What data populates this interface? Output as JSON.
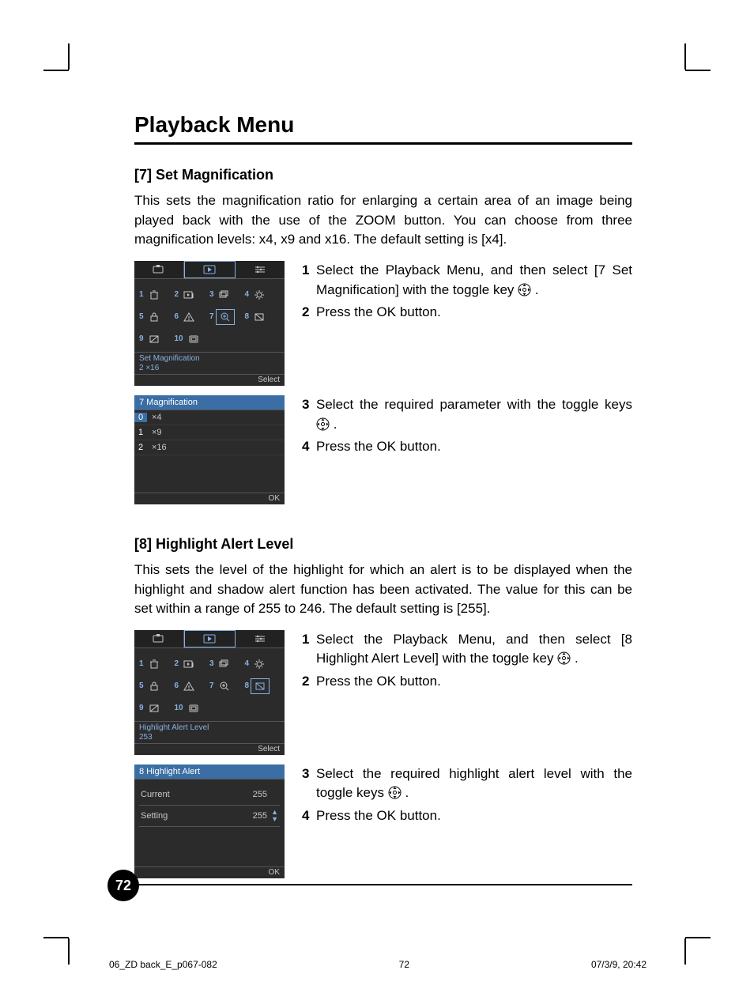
{
  "page_title": "Playback Menu",
  "page_number": "72",
  "footer": {
    "file_ref": "06_ZD back_E_p067-082",
    "page": "72",
    "timestamp": "07/3/9, 20:42"
  },
  "section1": {
    "heading": "[7] Set Magnification",
    "intro": "This sets the magnification ratio for enlarging a certain area of an image being played back with the use of the ZOOM button. You can choose from three magnification levels: x4, x9 and x16. The default setting is [x4].",
    "steps_a": {
      "s1": "Select the Playback Menu, and then select [7 Set Magnification] with the toggle key ",
      "s1_end": " .",
      "s2": "Press the OK button."
    },
    "steps_b": {
      "s3": "Select the required parameter with the toggle keys ",
      "s3_end": " .",
      "s4": "Press the OK button."
    },
    "menu_screen": {
      "status_line1": "Set Magnification",
      "status_line2": "2 ×16",
      "footer": "Select",
      "items": [
        "1",
        "2",
        "3",
        "4",
        "5",
        "6",
        "7",
        "8",
        "9",
        "10"
      ]
    },
    "list_screen": {
      "header": "7  Magnification",
      "footer": "OK",
      "options": [
        {
          "idx": "0",
          "label": "×4",
          "selected": true
        },
        {
          "idx": "1",
          "label": "×9",
          "selected": false
        },
        {
          "idx": "2",
          "label": "×16",
          "selected": false
        }
      ]
    }
  },
  "section2": {
    "heading": "[8] Highlight Alert Level",
    "intro": "This sets the level of the highlight for which an alert is to be displayed when the highlight and shadow alert function has been activated. The value for this can be set within a range of 255 to 246. The default setting is [255].",
    "steps_a": {
      "s1": "Select the Playback Menu, and then select [8 Highlight Alert Level] with the toggle key ",
      "s1_end": " .",
      "s2": "Press the OK button."
    },
    "steps_b": {
      "s3": "Select the required highlight alert level with the toggle keys ",
      "s3_end": " .",
      "s4": "Press the OK button."
    },
    "menu_screen": {
      "status_line1": "Highlight Alert Level",
      "status_line2": "253",
      "footer": "Select",
      "items": [
        "1",
        "2",
        "3",
        "4",
        "5",
        "6",
        "7",
        "8",
        "9",
        "10"
      ]
    },
    "table_screen": {
      "header": "8  Highlight Alert",
      "footer": "OK",
      "rows": [
        {
          "k": "Current",
          "v": "255"
        },
        {
          "k": "Setting",
          "v": "255"
        }
      ]
    }
  }
}
